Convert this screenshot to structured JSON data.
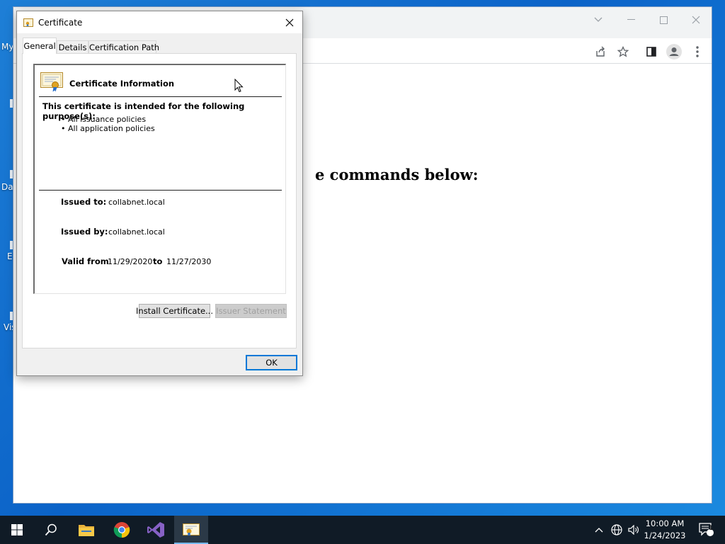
{
  "desktop": {
    "icon_labels": [
      "My",
      "Da",
      "E",
      "Vis"
    ]
  },
  "browser": {
    "page_heading": "e commands below:",
    "toolbar_icons": [
      "share-icon",
      "star-icon",
      "sidebar-icon",
      "profile-icon",
      "menu-icon"
    ],
    "window_controls": [
      "tab-search-icon",
      "minimize-icon",
      "maximize-icon",
      "close-icon"
    ]
  },
  "dialog": {
    "title": "Certificate",
    "tabs": [
      {
        "label": "General",
        "active": true
      },
      {
        "label": "Details",
        "active": false
      },
      {
        "label": "Certification Path",
        "active": false
      }
    ],
    "info_title": "Certificate Information",
    "purpose_heading": "This certificate is intended for the following purpose(s):",
    "purposes": [
      "• All issuance policies",
      "• All application policies"
    ],
    "issued_to_label": "Issued to:",
    "issued_to": "collabnet.local",
    "issued_by_label": "Issued by:",
    "issued_by": "collabnet.local",
    "valid_from_label": "Valid from",
    "valid_from": "11/29/2020",
    "to_label": "to",
    "valid_to": "11/27/2030",
    "install_button": "Install Certificate...",
    "issuer_statement_button": "Issuer Statement",
    "ok_button": "OK"
  },
  "taskbar": {
    "apps": [
      "start-icon",
      "search-icon",
      "file-explorer-icon",
      "chrome-icon",
      "visual-studio-icon",
      "certificate-app-icon"
    ],
    "time": "10:00 AM",
    "date": "1/24/2023",
    "notification_count": "1"
  },
  "colors": {
    "accent": "#0078d7",
    "desktop": "#0b63c8",
    "taskbar": "#101b26"
  }
}
